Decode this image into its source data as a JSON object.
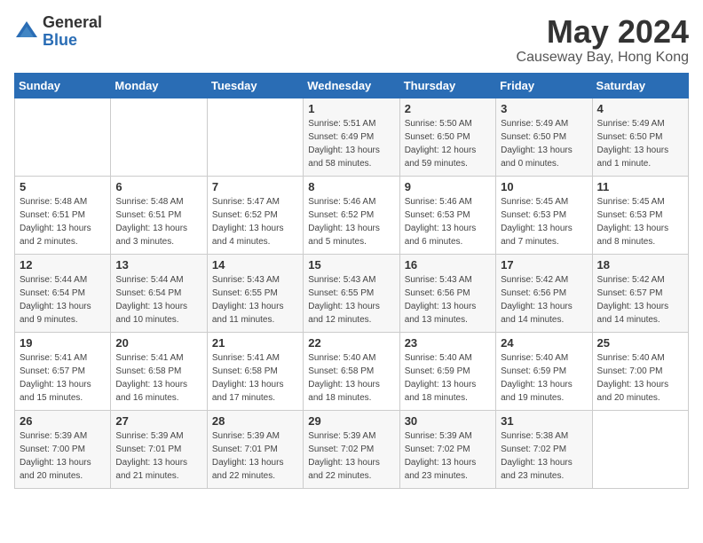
{
  "logo": {
    "general": "General",
    "blue": "Blue"
  },
  "title": "May 2024",
  "location": "Causeway Bay, Hong Kong",
  "days_of_week": [
    "Sunday",
    "Monday",
    "Tuesday",
    "Wednesday",
    "Thursday",
    "Friday",
    "Saturday"
  ],
  "weeks": [
    [
      {
        "day": "",
        "sunrise": "",
        "sunset": "",
        "daylight": ""
      },
      {
        "day": "",
        "sunrise": "",
        "sunset": "",
        "daylight": ""
      },
      {
        "day": "",
        "sunrise": "",
        "sunset": "",
        "daylight": ""
      },
      {
        "day": "1",
        "sunrise": "Sunrise: 5:51 AM",
        "sunset": "Sunset: 6:49 PM",
        "daylight": "Daylight: 13 hours and 58 minutes."
      },
      {
        "day": "2",
        "sunrise": "Sunrise: 5:50 AM",
        "sunset": "Sunset: 6:50 PM",
        "daylight": "Daylight: 12 hours and 59 minutes."
      },
      {
        "day": "3",
        "sunrise": "Sunrise: 5:49 AM",
        "sunset": "Sunset: 6:50 PM",
        "daylight": "Daylight: 13 hours and 0 minutes."
      },
      {
        "day": "4",
        "sunrise": "Sunrise: 5:49 AM",
        "sunset": "Sunset: 6:50 PM",
        "daylight": "Daylight: 13 hours and 1 minute."
      }
    ],
    [
      {
        "day": "5",
        "sunrise": "Sunrise: 5:48 AM",
        "sunset": "Sunset: 6:51 PM",
        "daylight": "Daylight: 13 hours and 2 minutes."
      },
      {
        "day": "6",
        "sunrise": "Sunrise: 5:48 AM",
        "sunset": "Sunset: 6:51 PM",
        "daylight": "Daylight: 13 hours and 3 minutes."
      },
      {
        "day": "7",
        "sunrise": "Sunrise: 5:47 AM",
        "sunset": "Sunset: 6:52 PM",
        "daylight": "Daylight: 13 hours and 4 minutes."
      },
      {
        "day": "8",
        "sunrise": "Sunrise: 5:46 AM",
        "sunset": "Sunset: 6:52 PM",
        "daylight": "Daylight: 13 hours and 5 minutes."
      },
      {
        "day": "9",
        "sunrise": "Sunrise: 5:46 AM",
        "sunset": "Sunset: 6:53 PM",
        "daylight": "Daylight: 13 hours and 6 minutes."
      },
      {
        "day": "10",
        "sunrise": "Sunrise: 5:45 AM",
        "sunset": "Sunset: 6:53 PM",
        "daylight": "Daylight: 13 hours and 7 minutes."
      },
      {
        "day": "11",
        "sunrise": "Sunrise: 5:45 AM",
        "sunset": "Sunset: 6:53 PM",
        "daylight": "Daylight: 13 hours and 8 minutes."
      }
    ],
    [
      {
        "day": "12",
        "sunrise": "Sunrise: 5:44 AM",
        "sunset": "Sunset: 6:54 PM",
        "daylight": "Daylight: 13 hours and 9 minutes."
      },
      {
        "day": "13",
        "sunrise": "Sunrise: 5:44 AM",
        "sunset": "Sunset: 6:54 PM",
        "daylight": "Daylight: 13 hours and 10 minutes."
      },
      {
        "day": "14",
        "sunrise": "Sunrise: 5:43 AM",
        "sunset": "Sunset: 6:55 PM",
        "daylight": "Daylight: 13 hours and 11 minutes."
      },
      {
        "day": "15",
        "sunrise": "Sunrise: 5:43 AM",
        "sunset": "Sunset: 6:55 PM",
        "daylight": "Daylight: 13 hours and 12 minutes."
      },
      {
        "day": "16",
        "sunrise": "Sunrise: 5:43 AM",
        "sunset": "Sunset: 6:56 PM",
        "daylight": "Daylight: 13 hours and 13 minutes."
      },
      {
        "day": "17",
        "sunrise": "Sunrise: 5:42 AM",
        "sunset": "Sunset: 6:56 PM",
        "daylight": "Daylight: 13 hours and 14 minutes."
      },
      {
        "day": "18",
        "sunrise": "Sunrise: 5:42 AM",
        "sunset": "Sunset: 6:57 PM",
        "daylight": "Daylight: 13 hours and 14 minutes."
      }
    ],
    [
      {
        "day": "19",
        "sunrise": "Sunrise: 5:41 AM",
        "sunset": "Sunset: 6:57 PM",
        "daylight": "Daylight: 13 hours and 15 minutes."
      },
      {
        "day": "20",
        "sunrise": "Sunrise: 5:41 AM",
        "sunset": "Sunset: 6:58 PM",
        "daylight": "Daylight: 13 hours and 16 minutes."
      },
      {
        "day": "21",
        "sunrise": "Sunrise: 5:41 AM",
        "sunset": "Sunset: 6:58 PM",
        "daylight": "Daylight: 13 hours and 17 minutes."
      },
      {
        "day": "22",
        "sunrise": "Sunrise: 5:40 AM",
        "sunset": "Sunset: 6:58 PM",
        "daylight": "Daylight: 13 hours and 18 minutes."
      },
      {
        "day": "23",
        "sunrise": "Sunrise: 5:40 AM",
        "sunset": "Sunset: 6:59 PM",
        "daylight": "Daylight: 13 hours and 18 minutes."
      },
      {
        "day": "24",
        "sunrise": "Sunrise: 5:40 AM",
        "sunset": "Sunset: 6:59 PM",
        "daylight": "Daylight: 13 hours and 19 minutes."
      },
      {
        "day": "25",
        "sunrise": "Sunrise: 5:40 AM",
        "sunset": "Sunset: 7:00 PM",
        "daylight": "Daylight: 13 hours and 20 minutes."
      }
    ],
    [
      {
        "day": "26",
        "sunrise": "Sunrise: 5:39 AM",
        "sunset": "Sunset: 7:00 PM",
        "daylight": "Daylight: 13 hours and 20 minutes."
      },
      {
        "day": "27",
        "sunrise": "Sunrise: 5:39 AM",
        "sunset": "Sunset: 7:01 PM",
        "daylight": "Daylight: 13 hours and 21 minutes."
      },
      {
        "day": "28",
        "sunrise": "Sunrise: 5:39 AM",
        "sunset": "Sunset: 7:01 PM",
        "daylight": "Daylight: 13 hours and 22 minutes."
      },
      {
        "day": "29",
        "sunrise": "Sunrise: 5:39 AM",
        "sunset": "Sunset: 7:02 PM",
        "daylight": "Daylight: 13 hours and 22 minutes."
      },
      {
        "day": "30",
        "sunrise": "Sunrise: 5:39 AM",
        "sunset": "Sunset: 7:02 PM",
        "daylight": "Daylight: 13 hours and 23 minutes."
      },
      {
        "day": "31",
        "sunrise": "Sunrise: 5:38 AM",
        "sunset": "Sunset: 7:02 PM",
        "daylight": "Daylight: 13 hours and 23 minutes."
      },
      {
        "day": "",
        "sunrise": "",
        "sunset": "",
        "daylight": ""
      }
    ]
  ]
}
